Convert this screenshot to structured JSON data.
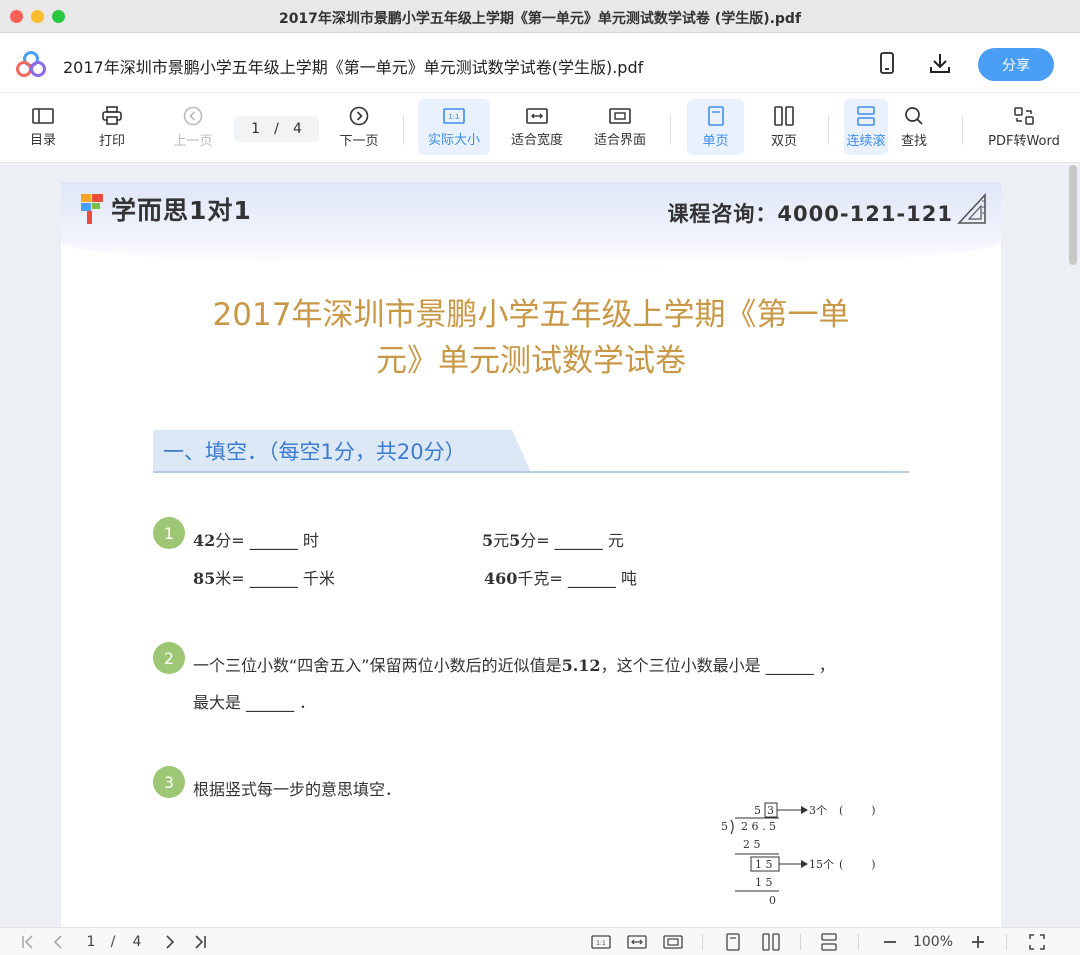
{
  "window": {
    "title": "2017年深圳市景鹏小学五年级上学期《第一单元》单元测试数学试卷 (学生版).pdf"
  },
  "header": {
    "doc_title": "2017年深圳市景鹏小学五年级上学期《第一单元》单元测试数学试卷(学生版).pdf",
    "share_label": "分享",
    "icons": [
      "mobile-icon",
      "download-icon"
    ]
  },
  "toolbar": {
    "toc": "目录",
    "print": "打印",
    "prev": "上一页",
    "page_current": "1",
    "page_sep": "/",
    "page_total": "4",
    "next": "下一页",
    "actual_size": "实际大小",
    "fit_width": "适合宽度",
    "fit_page": "适合界面",
    "single": "单页",
    "double": "双页",
    "continuous": "连续滚",
    "find": "查找",
    "pdf_to_word": "PDF转Word"
  },
  "document": {
    "brand": "学而思1对1",
    "hotline": "课程咨询：4000-121-121",
    "title_line1": "2017年深圳市景鹏小学五年级上学期《第一单",
    "title_line2": "元》单元测试数学试卷",
    "section": "一、填空．（每空1分，共20分）",
    "q1": {
      "num": "1",
      "a_prefix": "42",
      "a_text": "分= ______ 时",
      "b_prefix": "5",
      "b_mid": "元",
      "b_prefix2": "5",
      "b_text": "分= ______ 元",
      "c_prefix": "85",
      "c_text": "米= ______ 千米",
      "d_prefix": "460",
      "d_text": "千克= ______ 吨"
    },
    "q2": {
      "num": "2",
      "line1_a": "一个三位小数“四舍五入”保留两位小数后的近似值是",
      "line1_val": "5.12",
      "line1_b": "，这个三位小数最小是 ______ ，",
      "line2": "最大是 ______ ．"
    },
    "q3": {
      "num": "3",
      "text": "根据竖式每一步的意思填空．"
    },
    "division": {
      "quotient": "5 3",
      "boxed_digit": "3",
      "divisor": "5",
      "dividend": "2 6 . 5",
      "step1": "2 5",
      "remainder": "1 5",
      "step2": "1 5",
      "final": "0",
      "note1": "3个",
      "note2": "15个",
      "paren": "(        )"
    }
  },
  "bottombar": {
    "page_current": "1",
    "page_sep": "/",
    "page_total": "4",
    "zoom": "100%"
  }
}
